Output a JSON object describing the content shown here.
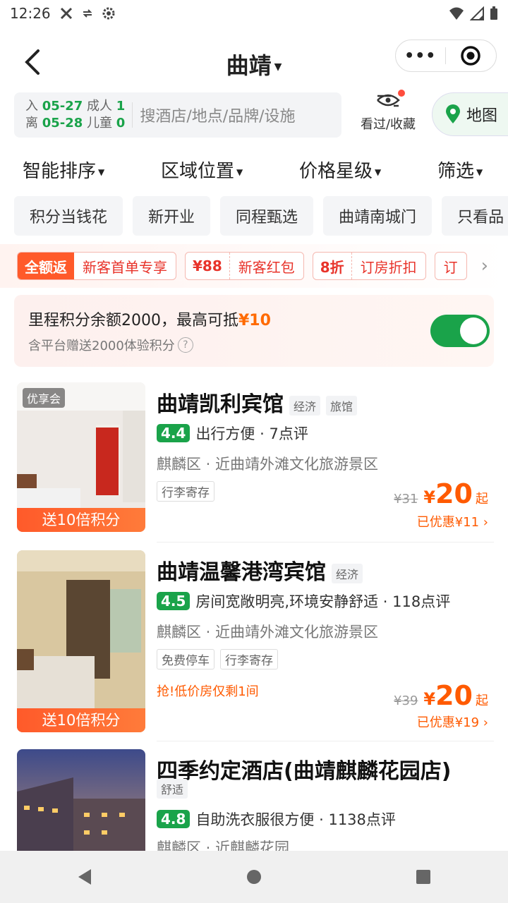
{
  "status": {
    "time": "12:26"
  },
  "nav": {
    "title": "曲靖",
    "more": "•••"
  },
  "search": {
    "checkin_label": "入",
    "checkin_date": "05-27",
    "checkout_label": "离",
    "checkout_date": "05-28",
    "adults_label": "成人",
    "adults": "1",
    "children_label": "儿童",
    "children": "0",
    "placeholder": "搜酒店/地点/品牌/设施"
  },
  "history_label": "看过/收藏",
  "map_label": "地图",
  "sort": [
    "智能排序",
    "区域位置",
    "价格星级",
    "筛选"
  ],
  "quick_tags": [
    "积分当钱花",
    "新开业",
    "同程甄选",
    "曲靖南城门",
    "只看品"
  ],
  "promos": [
    {
      "left": "全额返",
      "right": "新客首单专享"
    },
    {
      "left": "¥88",
      "right": "新客红包"
    },
    {
      "left": "8折",
      "right": "订房折扣"
    },
    {
      "left": "",
      "right": "订"
    }
  ],
  "points": {
    "text": "里程积分余额2000，最高可抵",
    "amount": "¥10",
    "sub": "含平台赠送2000体验积分",
    "toggle_on": true
  },
  "hotels": [
    {
      "badge": "优享会",
      "img_bottom": "送10倍积分",
      "name": "曲靖凯利宾馆",
      "types": [
        "经济",
        "旅馆"
      ],
      "score": "4.4",
      "review_text": "出行方便 · 7点评",
      "location": "麒麟区 · 近曲靖外滩文化旅游景区",
      "features": [
        "行李寄存"
      ],
      "urgent": "",
      "orig_price": "¥31",
      "yen": "¥",
      "price": "20",
      "qi": "起",
      "saved": "已优惠¥11 ›"
    },
    {
      "badge": "",
      "img_bottom": "送10倍积分",
      "name": "曲靖温馨港湾宾馆",
      "types": [
        "经济"
      ],
      "score": "4.5",
      "review_text": "房间宽敞明亮,环境安静舒适 · 118点评",
      "location": "麒麟区 · 近曲靖外滩文化旅游景区",
      "features": [
        "免费停车",
        "行李寄存"
      ],
      "urgent": "抢!低价房仅剩1间",
      "orig_price": "¥39",
      "yen": "¥",
      "price": "20",
      "qi": "起",
      "saved": "已优惠¥19 ›"
    },
    {
      "name": "四季约定酒店(曲靖麒麟花园店)",
      "types": [
        "舒适"
      ],
      "score": "4.8",
      "review_text": "自助洗衣服很方便 · 1138点评",
      "location": "麒麟区 · 近麒麟花园"
    }
  ]
}
